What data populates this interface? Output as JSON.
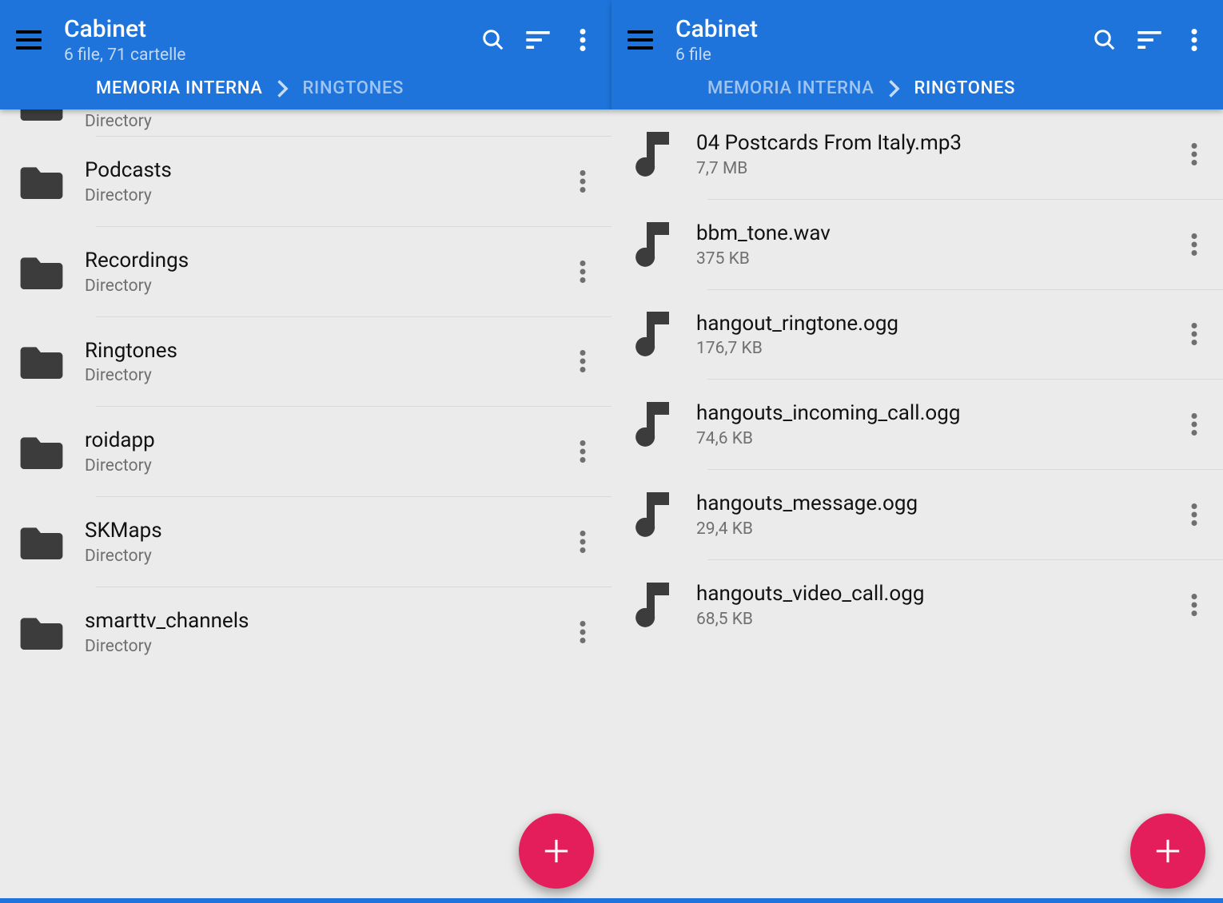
{
  "left": {
    "app_title": "Cabinet",
    "subtitle": "6 file, 71 cartelle",
    "breadcrumb": {
      "root": "MEMORIA INTERNA",
      "child": "RINGTONES"
    },
    "partial_sub": "Directory",
    "items": [
      {
        "name": "Podcasts",
        "sub": "Directory"
      },
      {
        "name": "Recordings",
        "sub": "Directory"
      },
      {
        "name": "Ringtones",
        "sub": "Directory"
      },
      {
        "name": "roidapp",
        "sub": "Directory"
      },
      {
        "name": "SKMaps",
        "sub": "Directory"
      },
      {
        "name": "smarttv_channels",
        "sub": "Directory"
      }
    ]
  },
  "right": {
    "app_title": "Cabinet",
    "subtitle": "6 file",
    "breadcrumb": {
      "root": "MEMORIA INTERNA",
      "child": "RINGTONES"
    },
    "items": [
      {
        "name": "04 Postcards From Italy.mp3",
        "sub": "7,7 MB"
      },
      {
        "name": "bbm_tone.wav",
        "sub": "375 KB"
      },
      {
        "name": "hangout_ringtone.ogg",
        "sub": "176,7 KB"
      },
      {
        "name": "hangouts_incoming_call.ogg",
        "sub": "74,6 KB"
      },
      {
        "name": "hangouts_message.ogg",
        "sub": "29,4 KB"
      },
      {
        "name": "hangouts_video_call.ogg",
        "sub": "68,5 KB"
      }
    ]
  }
}
